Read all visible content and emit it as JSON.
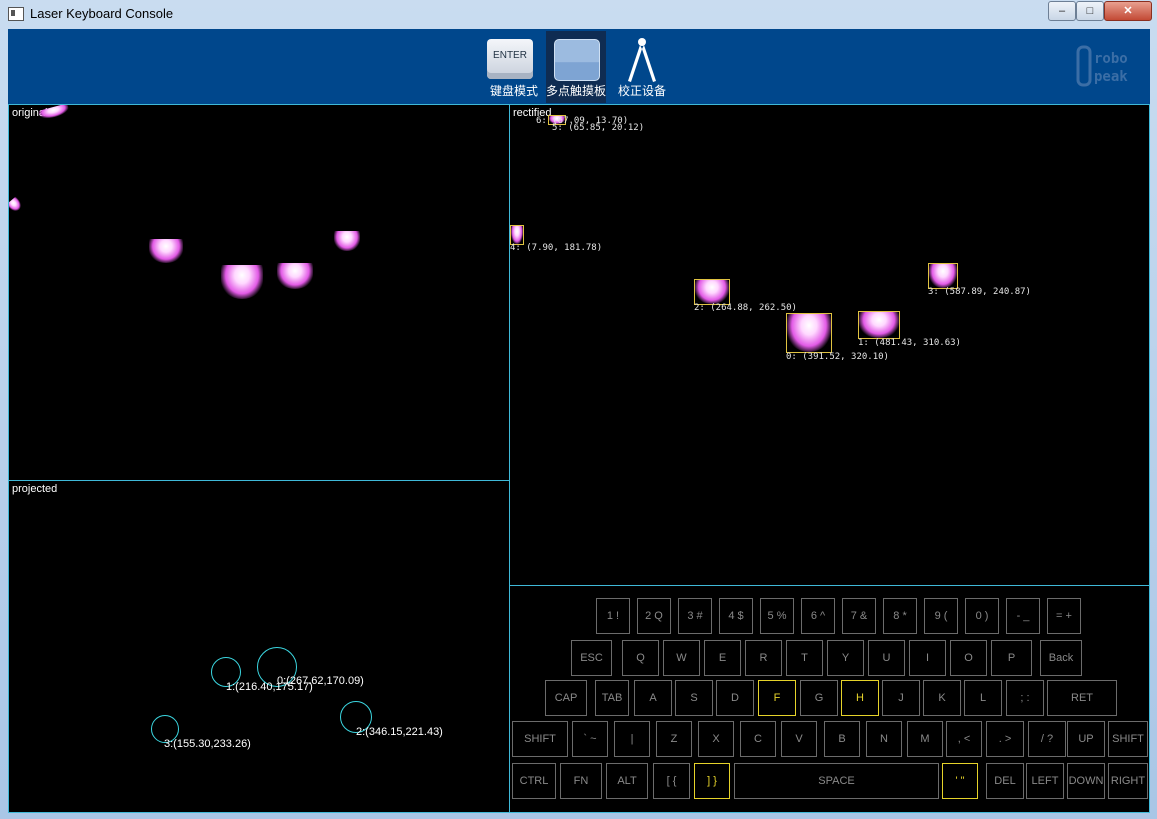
{
  "window": {
    "title": "Laser Keyboard Console",
    "min": "–",
    "max": "□",
    "close": "✕"
  },
  "toolbar": {
    "tools": [
      {
        "label": "键盘模式",
        "icon_text": "ENTER"
      },
      {
        "label": "多点触摸板"
      },
      {
        "label": "校正设备"
      }
    ],
    "logo": "robo\npeak"
  },
  "panels": {
    "original": "original",
    "projected": "projected",
    "rectified": "rectified"
  },
  "rectified_labels": [
    "6: (67.09, 13.70)",
    "5: (65.85, 20.12)",
    "4: (7.90, 181.78)",
    "2: (264.88, 262.50)",
    "3: (587.89, 240.87)",
    "1: (481.43, 310.63)",
    "0: (391.52, 320.10)"
  ],
  "projected_labels": [
    "0:(267.62,170.09)",
    "1:(216.40,175.17)",
    "2:(346.15,221.43)",
    "3:(155.30,233.26)"
  ],
  "keyboard": {
    "rows": [
      [
        "1 !",
        "2 Q",
        "3 #",
        "4 $",
        "5 %",
        "6 ^",
        "7 &",
        "8 *",
        "9 (",
        "0 )",
        "- _",
        "= +"
      ],
      [
        "ESC",
        "Q",
        "W",
        "E",
        "R",
        "T",
        "Y",
        "U",
        "I",
        "O",
        "P",
        "Back"
      ],
      [
        "CAP",
        "TAB",
        "A",
        "S",
        "D",
        "F",
        "G",
        "H",
        "J",
        "K",
        "L",
        "; :",
        "RET"
      ],
      [
        "SHIFT",
        "` ~",
        "|",
        "Z",
        "X",
        "C",
        "V",
        "B",
        "N",
        "M",
        ", <",
        ". >",
        "/ ?",
        "UP",
        "SHIFT"
      ],
      [
        "CTRL",
        "FN",
        "ALT",
        "[ {",
        "] }",
        "SPACE",
        "' \"",
        "DEL",
        "LEFT",
        "DOWN",
        "RIGHT"
      ]
    ],
    "highlighted": [
      "F",
      "H",
      "] }",
      "' \""
    ],
    "highlight_color": "#e6d32a"
  },
  "colors": {
    "toolbar_bg": "#00478c",
    "panel_border": "#3fb9d8",
    "box": "#e0c341",
    "circle": "#3bd6e0"
  }
}
